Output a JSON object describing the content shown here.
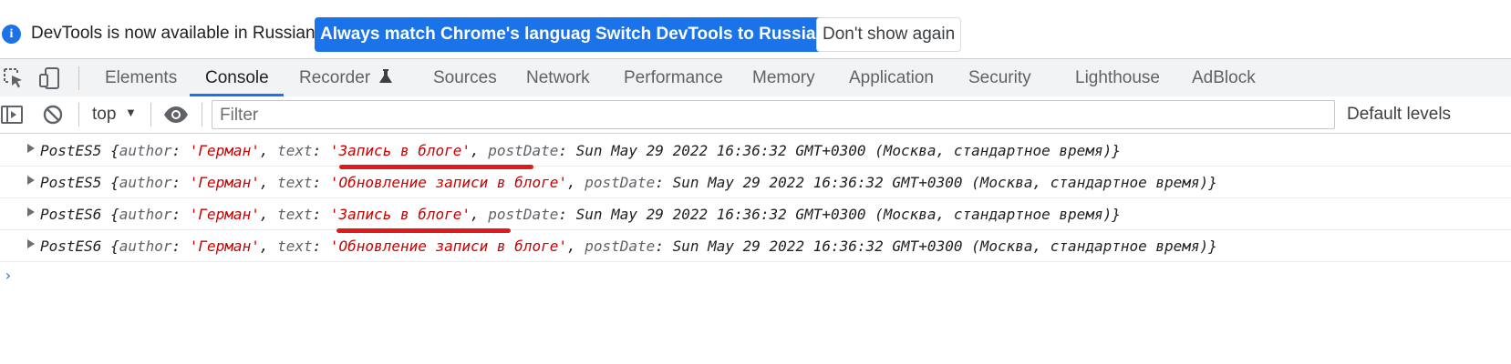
{
  "infobar": {
    "icon": "info-icon",
    "icon_glyph": "i",
    "message": "DevTools is now available in Russian!",
    "btn_match": "Always match Chrome's language",
    "btn_switch": "Switch DevTools to Russian",
    "btn_dismiss": "Don't show again",
    "accent": "#1a73e8"
  },
  "tabs": {
    "elements": "Elements",
    "console": "Console",
    "recorder": "Recorder",
    "sources": "Sources",
    "network": "Network",
    "performance": "Performance",
    "memory": "Memory",
    "application": "Application",
    "security": "Security",
    "lighthouse": "Lighthouse",
    "adblock": "AdBlock",
    "active": "Console"
  },
  "toolbar": {
    "context": "top",
    "filter_placeholder": "Filter",
    "levels": "Default levels"
  },
  "messages": [
    {
      "class": "PostES5",
      "author_key": "author",
      "author": "'Герман'",
      "text_key": "text",
      "text": "'Запись в блоге'",
      "date_key": "postDate",
      "date": "Sun May 29 2022 16:36:32 GMT+0300 (Москва, стандартное время)",
      "underlined": true
    },
    {
      "class": "PostES5",
      "author_key": "author",
      "author": "'Герман'",
      "text_key": "text",
      "text": "'Обновление записи в блоге'",
      "date_key": "postDate",
      "date": "Sun May 29 2022 16:36:32 GMT+0300 (Москва, стандартное время)",
      "underlined": false
    },
    {
      "class": "PostES6",
      "author_key": "author",
      "author": "'Герман'",
      "text_key": "text",
      "text": "'Запись в блоге'",
      "date_key": "postDate",
      "date": "Sun May 29 2022 16:36:32 GMT+0300 (Москва, стандартное время)",
      "underlined": true
    },
    {
      "class": "PostES6",
      "author_key": "author",
      "author": "'Герман'",
      "text_key": "text",
      "text": "'Обновление записи в блоге'",
      "date_key": "postDate",
      "date": "Sun May 29 2022 16:36:32 GMT+0300 (Москва, стандартное время)",
      "underlined": false
    }
  ],
  "prompt": "›",
  "colors": {
    "string": "#c80000",
    "key": "#5f6368",
    "annotation": "#e0191d"
  }
}
